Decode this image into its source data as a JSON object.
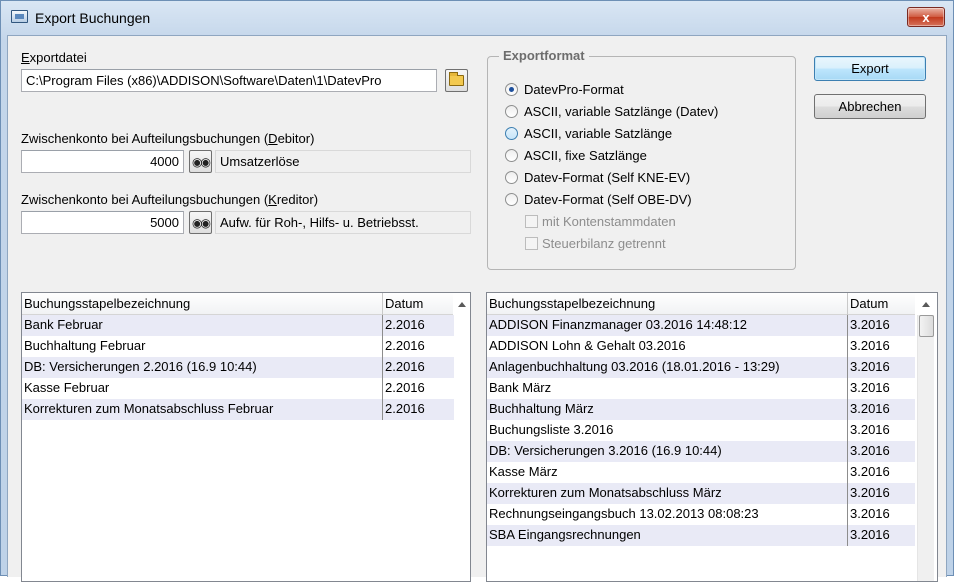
{
  "window": {
    "title": "Export Buchungen",
    "close_glyph": "x"
  },
  "exportfile": {
    "label_underlined": "E",
    "label_rest": "xportdatei",
    "value": "C:\\Program Files (x86)\\ADDISON\\Software\\Daten\\1\\DatevPro"
  },
  "debitor": {
    "label_pre": "Zwischenkonto bei Aufteilungsbuchungen (",
    "label_u": "D",
    "label_post": "ebitor)",
    "account": "4000",
    "description": "Umsatzerlöse"
  },
  "kreditor": {
    "label_pre": "Zwischenkonto bei Aufteilungsbuchungen (",
    "label_u": "K",
    "label_post": "reditor)",
    "account": "5000",
    "description": "Aufw. für Roh-, Hilfs- u. Betriebsst."
  },
  "exportformat": {
    "legend": "Exportformat",
    "options": [
      "DatevPro-Format",
      "ASCII, variable Satzlänge (Datev)",
      "ASCII, variable Satzlänge",
      "ASCII, fixe Satzlänge",
      "Datev-Format (Self KNE-EV)",
      "Datev-Format (Self OBE-DV)"
    ],
    "selected_index": 0,
    "checkboxes": [
      "mit Kontenstammdaten",
      "Steuerbilanz getrennt"
    ]
  },
  "buttons": {
    "export": "Export",
    "cancel": "Abbrechen"
  },
  "left_list": {
    "columns": [
      "Buchungsstapelbezeichnung",
      "Datum"
    ],
    "rows": [
      [
        "Bank Februar",
        "2.2016"
      ],
      [
        "Buchhaltung Februar",
        "2.2016"
      ],
      [
        "DB: Versicherungen 2.2016 (16.9 10:44)",
        "2.2016"
      ],
      [
        "Kasse Februar",
        "2.2016"
      ],
      [
        "Korrekturen zum Monatsabschluss Februar",
        "2.2016"
      ]
    ]
  },
  "right_list": {
    "columns": [
      "Buchungsstapelbezeichnung",
      "Datum"
    ],
    "rows": [
      [
        "ADDISON Finanzmanager 03.2016 14:48:12",
        "3.2016"
      ],
      [
        "ADDISON Lohn & Gehalt 03.2016",
        "3.2016"
      ],
      [
        "Anlagenbuchhaltung 03.2016 (18.01.2016 - 13:29)",
        "3.2016"
      ],
      [
        "Bank März",
        "3.2016"
      ],
      [
        "Buchhaltung März",
        "3.2016"
      ],
      [
        "Buchungsliste 3.2016",
        "3.2016"
      ],
      [
        "DB: Versicherungen 3.2016 (16.9 10:44)",
        "3.2016"
      ],
      [
        "Kasse März",
        "3.2016"
      ],
      [
        "Korrekturen zum Monatsabschluss März",
        "3.2016"
      ],
      [
        "Rechnungseingangsbuch 13.02.2013 08:08:23",
        "3.2016"
      ],
      [
        "SBA Eingangsrechnungen",
        "3.2016"
      ]
    ]
  }
}
